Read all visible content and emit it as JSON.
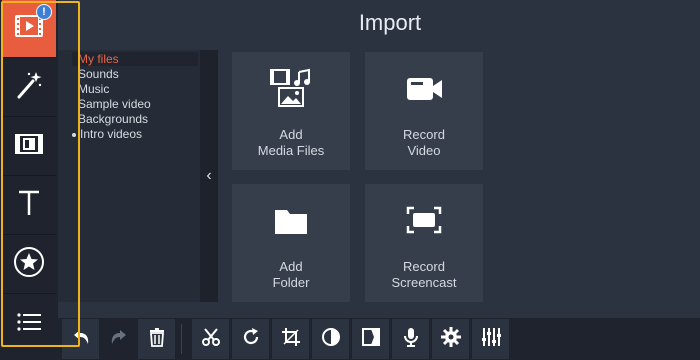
{
  "header": {
    "title": "Import"
  },
  "sidebar": {
    "badge": "!",
    "items": [
      {
        "name": "import",
        "icon": "film-import-icon",
        "active": true
      },
      {
        "name": "filters",
        "icon": "magic-wand-icon"
      },
      {
        "name": "transitions",
        "icon": "transitions-icon"
      },
      {
        "name": "titles",
        "icon": "text-title-icon"
      },
      {
        "name": "stickers",
        "icon": "sticker-star-icon"
      },
      {
        "name": "more",
        "icon": "list-icon"
      }
    ]
  },
  "file_tree": {
    "items": [
      {
        "label": "My files",
        "selected": true
      },
      {
        "label": "Sounds"
      },
      {
        "label": "Music"
      },
      {
        "label": "Sample video"
      },
      {
        "label": "Backgrounds"
      },
      {
        "label": "Intro videos",
        "bullet": true
      }
    ],
    "collapse_glyph": "‹"
  },
  "tiles": [
    {
      "label": "Add\nMedia Files",
      "icon": "add-media-icon"
    },
    {
      "label": "Record\nVideo",
      "icon": "video-camera-icon"
    },
    {
      "label": "Add\nFolder",
      "icon": "folder-icon"
    },
    {
      "label": "Record\nScreencast",
      "icon": "screencast-icon"
    }
  ],
  "toolbar": {
    "tools": [
      "undo-icon",
      "redo-icon",
      "delete-icon",
      "cut-icon",
      "rotate-icon",
      "crop-icon",
      "color-adjust-icon",
      "transition-icon",
      "microphone-icon",
      "settings-icon",
      "equalizer-icon"
    ]
  },
  "colors": {
    "accent": "#e85d3d",
    "highlight": "#f2b21c",
    "badge": "#3d7fd6",
    "background": "#2b3240"
  }
}
